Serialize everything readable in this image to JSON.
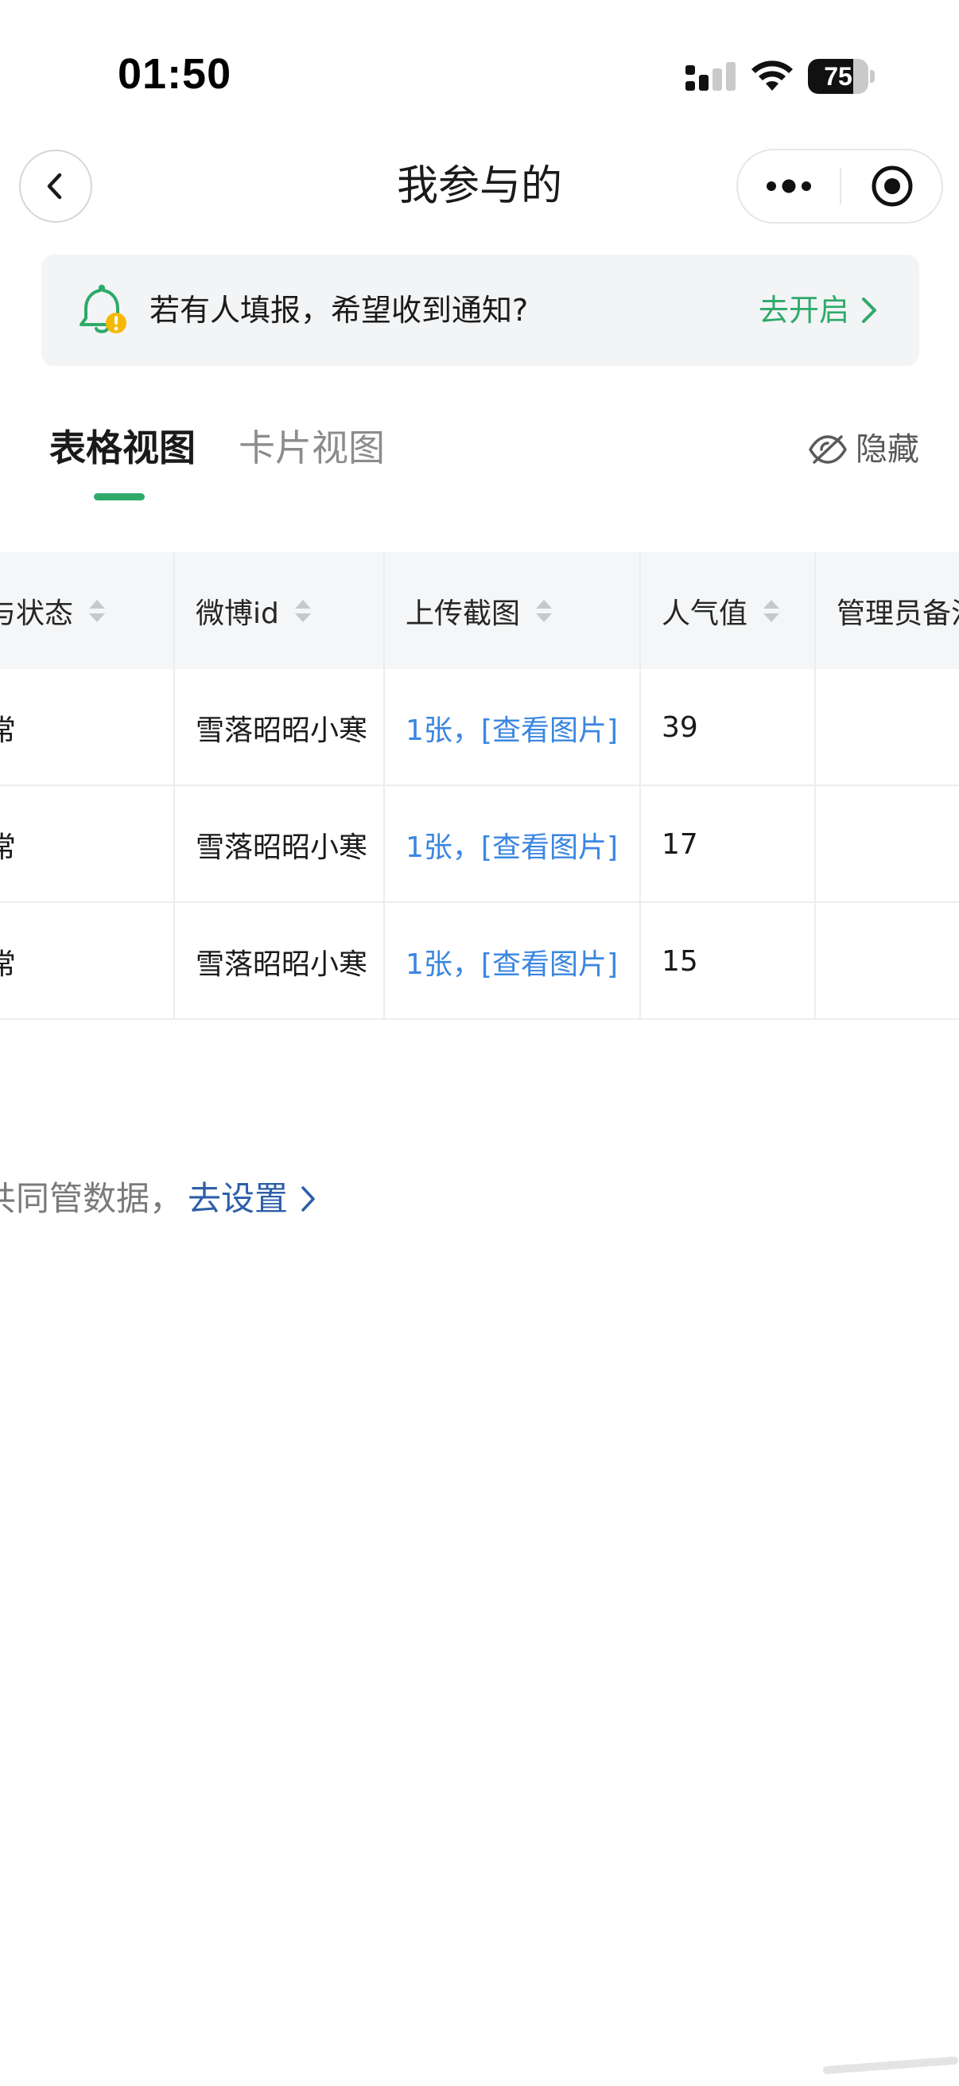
{
  "status_bar": {
    "time": "01:50",
    "battery_level": "75",
    "battery_percent": 75
  },
  "nav": {
    "title": "我参与的"
  },
  "notice": {
    "text": "若有人填报，希望收到通知?",
    "action": "去开启"
  },
  "tabs": [
    {
      "label": "表格视图",
      "active": true
    },
    {
      "label": "卡片视图",
      "active": false
    }
  ],
  "hide_label": "隐藏",
  "table": {
    "columns": [
      "与状态",
      "微博id",
      "上传截图",
      "人气值",
      "管理员备注"
    ],
    "rows": [
      [
        "常",
        "雪落昭昭小寒",
        "1张，[查看图片]",
        "39",
        ""
      ],
      [
        "常",
        "雪落昭昭小寒",
        "1张，[查看图片]",
        "17",
        ""
      ],
      [
        "常",
        "雪落昭昭小寒",
        "1张，[查看图片]",
        "15",
        ""
      ]
    ]
  },
  "footer": {
    "text": "共同管数据，",
    "link": "去设置"
  },
  "colors": {
    "accent_green": "#2eaa6a",
    "link_blue": "#3a86e0",
    "footer_link": "#2d5fa8"
  }
}
